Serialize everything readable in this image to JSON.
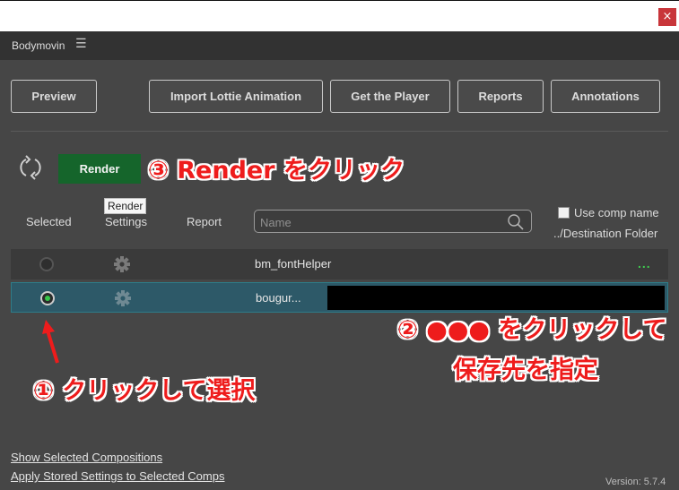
{
  "window": {
    "close_glyph": "×"
  },
  "panel": {
    "title": "Bodymovin",
    "menu_glyph": "☰"
  },
  "toolbar": {
    "preview": "Preview",
    "import": "Import Lottie Animation",
    "get_player": "Get the Player",
    "reports": "Reports",
    "annotations": "Annotations"
  },
  "render": {
    "label": "Render",
    "tooltip": "Render"
  },
  "columns": {
    "selected": "Selected",
    "settings": "Settings",
    "report": "Report"
  },
  "search": {
    "placeholder": "Name"
  },
  "options": {
    "use_comp_name": "Use comp name",
    "destination_folder": "../Destination Folder"
  },
  "compositions": [
    {
      "name": "bm_fontHelper",
      "selected": false,
      "dest": "..."
    },
    {
      "name": "bougur...",
      "selected": true,
      "dest": ""
    }
  ],
  "annotations": {
    "step3": "③ Render をクリック",
    "step2_line1": "② ●●● をクリックして",
    "step2_line2": "保存先を指定",
    "step1": "① クリックして選択"
  },
  "footer": {
    "show_selected": "Show Selected Compositions",
    "apply_stored": "Apply Stored Settings to Selected Comps",
    "version": "Version: 5.7.4"
  },
  "colors": {
    "panel": "#464646",
    "header": "#323232",
    "render_green": "#15652b",
    "selected_row": "#2d5968",
    "annotation_red": "#ee1c1c"
  }
}
